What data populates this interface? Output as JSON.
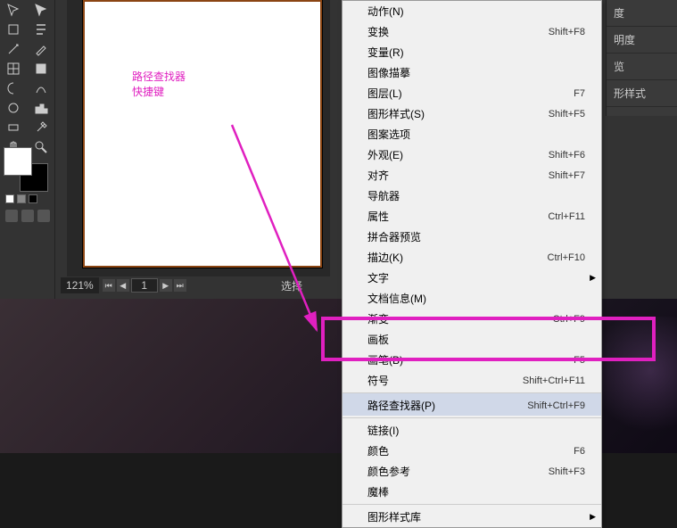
{
  "annotation": {
    "line1": "路径查找器",
    "line2": "快捷键"
  },
  "status": {
    "zoom": "121%",
    "page": "1",
    "select_label": "选择"
  },
  "panels": {
    "items": [
      "度",
      "明度",
      "览",
      "形样式"
    ]
  },
  "swatches": {
    "fg": "#ffffff",
    "bg": "#000000"
  },
  "menu": [
    {
      "label": "动作(N)",
      "shortcut": ""
    },
    {
      "label": "变换",
      "shortcut": "Shift+F8"
    },
    {
      "label": "变量(R)",
      "shortcut": ""
    },
    {
      "label": "图像描摹",
      "shortcut": ""
    },
    {
      "label": "图层(L)",
      "shortcut": "F7"
    },
    {
      "label": "图形样式(S)",
      "shortcut": "Shift+F5"
    },
    {
      "label": "图案选项",
      "shortcut": ""
    },
    {
      "label": "外观(E)",
      "shortcut": "Shift+F6"
    },
    {
      "label": "对齐",
      "shortcut": "Shift+F7"
    },
    {
      "label": "导航器",
      "shortcut": ""
    },
    {
      "label": "属性",
      "shortcut": "Ctrl+F11"
    },
    {
      "label": "拼合器预览",
      "shortcut": ""
    },
    {
      "label": "描边(K)",
      "shortcut": "Ctrl+F10"
    },
    {
      "label": "文字",
      "shortcut": "",
      "sub": true
    },
    {
      "label": "文档信息(M)",
      "shortcut": ""
    },
    {
      "label": "渐变",
      "shortcut": "Ctrl+F9"
    },
    {
      "label": "画板",
      "shortcut": ""
    },
    {
      "label": "画笔(B)",
      "shortcut": "F5"
    },
    {
      "label": "符号",
      "shortcut": "Shift+Ctrl+F11"
    },
    {
      "label": "路径查找器(P)",
      "shortcut": "Shift+Ctrl+F9",
      "highlight": true,
      "sep": true
    },
    {
      "label": "链接(I)",
      "shortcut": "",
      "sep": true
    },
    {
      "label": "颜色",
      "shortcut": "F6"
    },
    {
      "label": "颜色参考",
      "shortcut": "Shift+F3"
    },
    {
      "label": "魔棒",
      "shortcut": ""
    },
    {
      "label": "图形样式库",
      "shortcut": "",
      "sub": true,
      "sep": true
    }
  ]
}
